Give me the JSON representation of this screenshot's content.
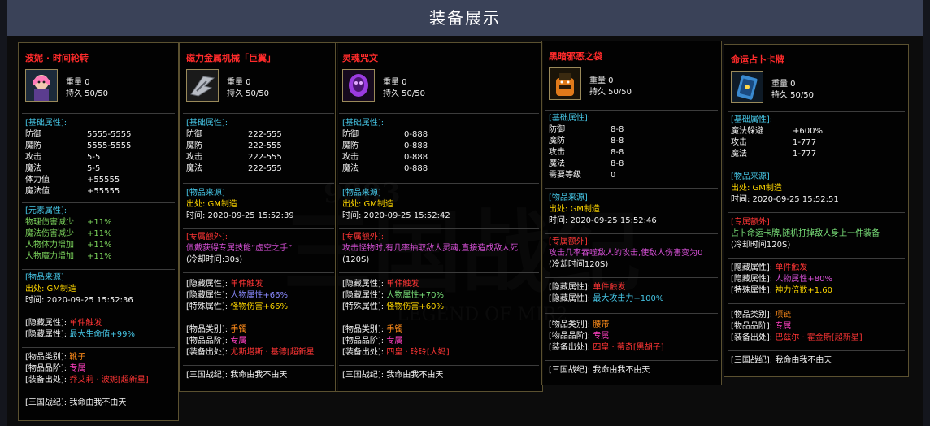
{
  "page": {
    "title": "装备展示"
  },
  "cards": [
    {
      "name": "波妮 · 时间轮转",
      "weight": "重量 0",
      "durability": "持久 50/50",
      "base_header": "[基础属性]:",
      "base": [
        {
          "k": "防御",
          "v": "5555-5555"
        },
        {
          "k": "魔防",
          "v": "5555-5555"
        },
        {
          "k": "攻击",
          "v": "5-5"
        },
        {
          "k": "魔法",
          "v": "5-5"
        },
        {
          "k": "体力值",
          "v": "+55555"
        },
        {
          "k": "魔法值",
          "v": "+55555"
        }
      ],
      "elem_header": "[元素属性]:",
      "elem": [
        {
          "k": "物理伤害减少",
          "v": "+11%"
        },
        {
          "k": "魔法伤害减少",
          "v": "+11%"
        },
        {
          "k": "人物体力增加",
          "v": "+11%"
        },
        {
          "k": "人物魔力增加",
          "v": "+11%"
        }
      ],
      "source_header": "[物品来源]",
      "source_from": "出处: GM制造",
      "source_time": "时间: 2020-09-25 15:52:36",
      "hidden1_label": "[隐藏属性]:",
      "hidden1_value": "单件触发",
      "hidden2_label": "[隐藏属性]:",
      "hidden2_value": "最大生命值+99%",
      "cat_label": "[物品类别]:",
      "cat_value": "靴子",
      "grade_label": "[物品品阶]:",
      "grade_value": "专属",
      "drop_label": "[装备出处]:",
      "drop_value": "乔艾莉 · 波妮[超新星]",
      "series": "[三国战纪]: 我命由我不由天"
    },
    {
      "name": "磁力金属机械「巨翼」",
      "weight": "重量 0",
      "durability": "持久 50/50",
      "base_header": "[基础属性]:",
      "base": [
        {
          "k": "防御",
          "v": "222-555"
        },
        {
          "k": "魔防",
          "v": "222-555"
        },
        {
          "k": "攻击",
          "v": "222-555"
        },
        {
          "k": "魔法",
          "v": "222-555"
        }
      ],
      "source_header": "[物品来源]",
      "source_from": "出处: GM制造",
      "source_time": "时间: 2020-09-25 15:52:39",
      "extra_header": "[专属额外]:",
      "extra_text": "佩戴获得专属技能“虚空之手”",
      "extra_note": "(冷却时间:30s)",
      "hidden1_label": "[隐藏属性]:",
      "hidden1_value": "单件触发",
      "hidden2_label": "[隐藏属性]:",
      "hidden2_value": "人物属性+66%",
      "special_label": "[特殊属性]:",
      "special_value": "怪物伤害+66%",
      "cat_label": "[物品类别]:",
      "cat_value": "手镯",
      "grade_label": "[物品品阶]:",
      "grade_value": "专属",
      "drop_label": "[装备出处]:",
      "drop_value": "尤斯塔斯 · 基德[超新星",
      "series": "[三国战纪]: 我命由我不由天"
    },
    {
      "name": "灵魂咒文",
      "weight": "重量 0",
      "durability": "持久 50/50",
      "base_header": "[基础属性]:",
      "base": [
        {
          "k": "防御",
          "v": "0-888"
        },
        {
          "k": "魔防",
          "v": "0-888"
        },
        {
          "k": "攻击",
          "v": "0-888"
        },
        {
          "k": "魔法",
          "v": "0-888"
        }
      ],
      "source_header": "[物品来源]",
      "source_from": "出处: GM制造",
      "source_time": "时间: 2020-09-25 15:52:42",
      "extra_header": "[专属额外]:",
      "extra_text": "攻击怪物时,有几率抽取敌人灵魂,直接造成敌人死",
      "extra_note": "(120S)",
      "hidden1_label": "[隐藏属性]:",
      "hidden1_value": "单件触发",
      "hidden2_label": "[隐藏属性]:",
      "hidden2_value": "人物属性+70%",
      "special_label": "[特殊属性]:",
      "special_value": "怪物伤害+60%",
      "cat_label": "[物品类别]:",
      "cat_value": "手镯",
      "grade_label": "[物品品阶]:",
      "grade_value": "专属",
      "drop_label": "[装备出处]:",
      "drop_value": "四皇 · 玲玲[大妈]",
      "series": "[三国战纪]: 我命由我不由天"
    },
    {
      "name": "黑暗邪恶之袋",
      "weight": "重量 0",
      "durability": "持久 50/50",
      "base_header": "[基础属性]:",
      "base": [
        {
          "k": "防御",
          "v": "8-8"
        },
        {
          "k": "魔防",
          "v": "8-8"
        },
        {
          "k": "攻击",
          "v": "8-8"
        },
        {
          "k": "魔法",
          "v": "8-8"
        },
        {
          "k": "需要等级",
          "v": "0"
        }
      ],
      "source_header": "[物品来源]",
      "source_from": "出处: GM制造",
      "source_time": "时间: 2020-09-25 15:52:46",
      "extra_header": "[专属额外]:",
      "extra_text": "攻击几率吞噬敌人的攻击,使敌人伤害变为0",
      "extra_note": "(冷却时间120S)",
      "hidden1_label": "[隐藏属性]:",
      "hidden1_value": "单件触发",
      "hidden2_label": "[隐藏属性]:",
      "hidden2_value": "最大攻击力+100%",
      "cat_label": "[物品类别]:",
      "cat_value": "腰带",
      "grade_label": "[物品品阶]:",
      "grade_value": "专属",
      "drop_label": "[装备出处]:",
      "drop_value": "四皇 · 蒂奇[黑胡子]",
      "series": "[三国战纪]: 我命由我不由天"
    },
    {
      "name": "命运占卜卡牌",
      "weight": "重量 0",
      "durability": "持久 50/50",
      "base_header": "[基础属性]:",
      "base": [
        {
          "k": "魔法躲避",
          "v": "+600%"
        },
        {
          "k": "攻击",
          "v": "1-777"
        },
        {
          "k": "魔法",
          "v": "1-777"
        }
      ],
      "source_header": "[物品来源]",
      "source_from": "出处: GM制造",
      "source_time": "时间: 2020-09-25 15:52:51",
      "extra_header": "[专属额外]:",
      "extra_text": "占卜命运卡牌,随机打掉敌人身上一件装备",
      "extra_note": "(冷却时间120S)",
      "hidden1_label": "[隐藏属性]:",
      "hidden1_value": "单件触发",
      "hidden2_label": "[隐藏属性]:",
      "hidden2_value": "人物属性+80%",
      "special_label": "[特殊属性]:",
      "special_value": "神力倍数+1.60",
      "cat_label": "[物品类别]:",
      "cat_value": "项链",
      "grade_label": "[物品品阶]:",
      "grade_value": "专属",
      "drop_label": "[装备出处]:",
      "drop_value": "巴兹尔 · 霍金斯[超新星]",
      "series": "[三国战纪]: 我命由我不由天"
    }
  ],
  "watermark": {
    "number": "9803",
    "big": "三国战纪",
    "sub": "LEGEND OF MIR2"
  }
}
